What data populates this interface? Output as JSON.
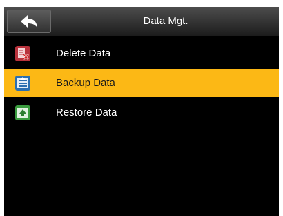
{
  "header": {
    "title": "Data Mgt.",
    "back_icon": "back-arrow-icon"
  },
  "menu": {
    "items": [
      {
        "label": "Delete Data",
        "icon": "delete-data-icon",
        "selected": false
      },
      {
        "label": "Backup Data",
        "icon": "backup-data-icon",
        "selected": true
      },
      {
        "label": "Restore Data",
        "icon": "restore-data-icon",
        "selected": false
      }
    ]
  },
  "colors": {
    "selection": "#fcb815",
    "background": "#000000",
    "header": "#2e2e2e",
    "text": "#ffffff"
  }
}
